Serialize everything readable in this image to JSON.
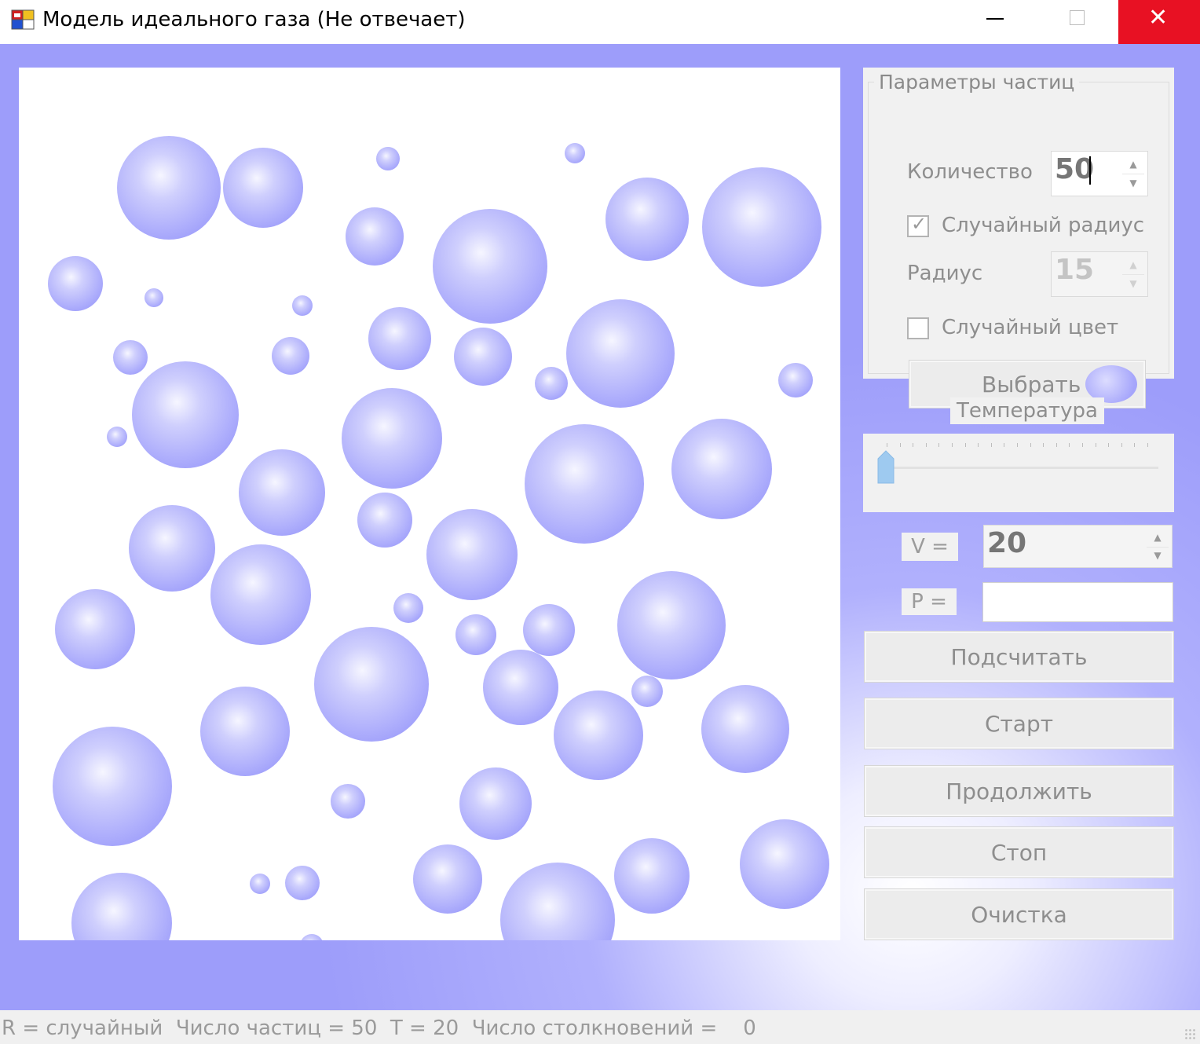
{
  "window": {
    "title": "Модель идеального газа (Не отвечает)",
    "minimize_icon": "minimize-icon",
    "maximize_icon": "maximize-icon",
    "close_icon": "close-icon",
    "close_glyph": "✕"
  },
  "particles_group": {
    "title": "Параметры частиц",
    "count_label": "Количество",
    "count_value": "50",
    "random_radius_label": "Случайный радиус",
    "random_radius_checked": true,
    "radius_label": "Радиус",
    "radius_value": "15",
    "random_color_label": "Случайный цвет",
    "random_color_checked": false,
    "choose_button_label": "Выбрать",
    "particle_color": "#a5a5fb"
  },
  "temperature": {
    "label": "Температура",
    "slider_value": 0
  },
  "volume": {
    "label": "V =",
    "value": "20"
  },
  "pressure": {
    "label": "P =",
    "value": ""
  },
  "buttons": {
    "calculate": "Подсчитать",
    "start": "Старт",
    "continue": "Продолжить",
    "stop": "Стоп",
    "clear": "Очистка"
  },
  "status": {
    "text": "R = случайный  Число частиц = 50  T = 20  Число столкновений =    0"
  },
  "colors": {
    "background": "#9d9dfa",
    "particle_light": "#e8e8ff",
    "particle_dark": "#a3a3fb",
    "close_red": "#e81123"
  }
}
